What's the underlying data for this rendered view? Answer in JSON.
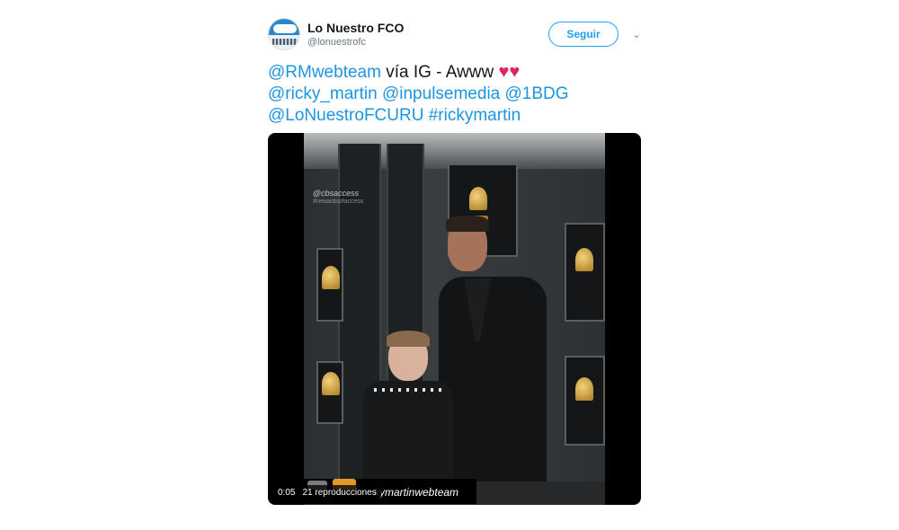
{
  "tweet": {
    "author_name": "Lo Nuestro FCO",
    "author_handle": "@lonuestrofc",
    "follow_label": "Seguir",
    "text_line1_mention": "@RMwebteam",
    "text_line1_rest": " vía IG  - Awww ",
    "hearts": "♥♥",
    "mention_ricky": "@ricky_martin",
    "mention_inpulse": "@inpulsemedia",
    "mention_1bdg": "@1BDG",
    "mention_lonuestro": "@LoNuestroFCURU",
    "hashtag": "#rickymartin"
  },
  "media": {
    "time": "0:05",
    "views": "21 reproducciones",
    "caption": "kymartinwebteam",
    "watermark": "@cbsaccess",
    "watermark_sub": "#rewardsofaccess"
  },
  "colors": {
    "link": "#1b95e0",
    "follow_accent": "#1da1f2",
    "heart": "#e0245e",
    "text": "#14171a",
    "muted": "#657786"
  },
  "icons": {
    "chevron": "chevron-down-icon",
    "heart": "heart-icon",
    "avatar": "avatar"
  }
}
